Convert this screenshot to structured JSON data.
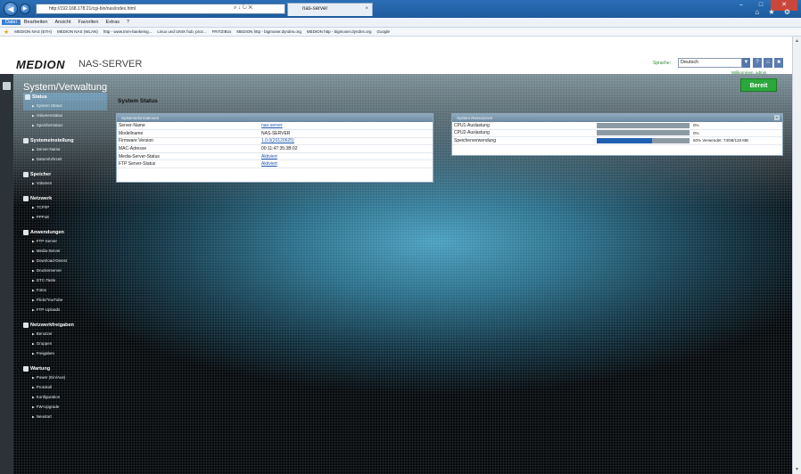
{
  "browser": {
    "address": "http://192.168.178.21/cgi-bin/nas/index.html",
    "address_controls": "⌕ ↓ ↻ ✕",
    "tab_title": "nas-server",
    "tab_close": "×",
    "menu": [
      "Datei",
      "Bearbeiten",
      "Ansicht",
      "Favoriten",
      "Extras",
      "?"
    ],
    "favorites": [
      "MEDION NAS (ETH)",
      "MEDION NAS (WLAN)",
      "http - www.tmm-bankeing...",
      "Linux und UNIX hub, proz...",
      "FRITZ!Box",
      "MEDION http - bigmoser.dyndns.org",
      "MEDION http - bigmoser.dyndns.org",
      "Google"
    ],
    "window_buttons": [
      "–",
      "□",
      "✕"
    ],
    "toolbar_icons": "⌂ ★ ⚙"
  },
  "header": {
    "logo": "MEDION",
    "product": "NAS-SERVER",
    "language_label": "Sprache:",
    "language_value": "Deutsch",
    "user_line": "Willkommen, admin"
  },
  "page": {
    "section_title": "System/Verwaltung",
    "status_button": "Bereit",
    "content_title": "System Status"
  },
  "sidebar": [
    {
      "label": "Status",
      "active": true,
      "items": [
        {
          "label": "System Status",
          "active": true
        },
        {
          "label": "Volumenstatus",
          "active": false
        },
        {
          "label": "Speicherstatus",
          "active": false
        }
      ]
    },
    {
      "label": "Systemeinstellung",
      "active": false,
      "items": [
        {
          "label": "Server-Name",
          "active": false
        },
        {
          "label": "Datum/Uhrzeit",
          "active": false
        }
      ]
    },
    {
      "label": "Speicher",
      "active": false,
      "items": [
        {
          "label": "Volumen",
          "active": false
        }
      ]
    },
    {
      "label": "Netzwerk",
      "active": false,
      "items": [
        {
          "label": "TCP/IP",
          "active": false
        },
        {
          "label": "PPPoE",
          "active": false
        }
      ]
    },
    {
      "label": "Anwendungen",
      "active": false,
      "items": [
        {
          "label": "FTP-Server",
          "active": false
        },
        {
          "label": "Media-Server",
          "active": false
        },
        {
          "label": "Download-Dienst",
          "active": false
        },
        {
          "label": "Druckerserver",
          "active": false
        },
        {
          "label": "DTC-Taste",
          "active": false
        },
        {
          "label": "Fotos",
          "active": false
        },
        {
          "label": "Flickr/YouTube",
          "active": false
        },
        {
          "label": "FTP-Uploads",
          "active": false
        }
      ]
    },
    {
      "label": "Netzwerkfreigaben",
      "active": false,
      "items": [
        {
          "label": "Benutzer",
          "active": false
        },
        {
          "label": "Gruppen",
          "active": false
        },
        {
          "label": "Freigaben",
          "active": false
        }
      ]
    },
    {
      "label": "Wartung",
      "active": false,
      "items": [
        {
          "label": "Power (Ein/Aus)",
          "active": false
        },
        {
          "label": "Protokoll",
          "active": false
        },
        {
          "label": "Konfiguration",
          "active": false
        },
        {
          "label": "FW-Upgrade",
          "active": false
        },
        {
          "label": "Neustart",
          "active": false
        }
      ]
    }
  ],
  "system_info": {
    "title": "Systeminformationen",
    "rows": [
      {
        "label": "Server-Name",
        "value": "nas-server",
        "link": true
      },
      {
        "label": "Modellname",
        "value": "NAS-SERVER",
        "link": false
      },
      {
        "label": "Firmware Version",
        "value": "1.0.0(20120625)",
        "link": true
      },
      {
        "label": "MAC-Adresse",
        "value": "00:11:47:35:3B:02",
        "link": false
      },
      {
        "label": "Media-Server-Status",
        "value": "Aktiviert",
        "link": true
      },
      {
        "label": "FTP Server-Status",
        "value": "Aktiviert",
        "link": true
      }
    ]
  },
  "system_resources": {
    "title": "System Ressourcen",
    "close": "x",
    "rows": [
      {
        "label": "CPU1-Auslastung",
        "value": "0%",
        "percent": 0
      },
      {
        "label": "CPU2-Auslastung",
        "value": "0%",
        "percent": 0
      },
      {
        "label": "Speicherverwendung",
        "value": "60% Verwendet: 73/98/128 MB",
        "percent": 60
      }
    ]
  }
}
